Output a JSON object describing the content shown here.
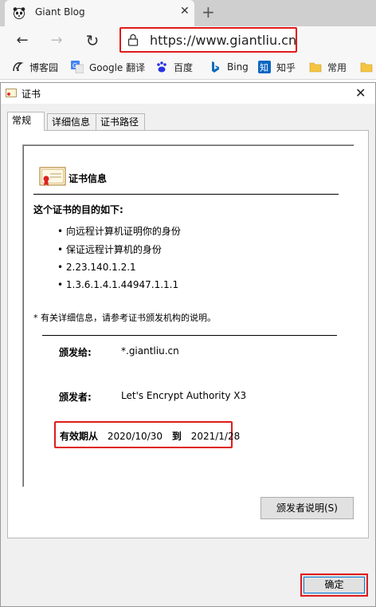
{
  "browser": {
    "tab_title": "Giant Blog",
    "tab_close": "✕",
    "new_tab": "+",
    "url": "https://www.giantliu.cn",
    "nav": {
      "back": "←",
      "forward": "→",
      "refresh": "↻"
    }
  },
  "favorites": [
    {
      "label": "博客园",
      "icon": "blog-icon"
    },
    {
      "label": "Google 翻译",
      "icon": "google-translate-icon"
    },
    {
      "label": "百度",
      "icon": "baidu-icon"
    },
    {
      "label": "Bing",
      "icon": "bing-icon"
    },
    {
      "label": "知乎",
      "icon": "zhihu-icon"
    },
    {
      "label": "常用",
      "icon": "folder-icon"
    }
  ],
  "dialog": {
    "title": "证书",
    "close": "✕",
    "tabs": [
      "常规",
      "详细信息",
      "证书路径"
    ],
    "cert_header": "证书信息",
    "purpose_header": "这个证书的目的如下:",
    "purposes": [
      "• 向远程计算机证明你的身份",
      "• 保证远程计算机的身份",
      "• 2.23.140.1.2.1",
      "• 1.3.6.1.4.1.44947.1.1.1"
    ],
    "footnote": "* 有关详细信息，请参考证书颁发机构的说明。",
    "issued_to_label": "颁发给:",
    "issued_to_value": "*.giantliu.cn",
    "issued_by_label": "颁发者:",
    "issued_by_value": "Let's Encrypt Authority X3",
    "valid_from_label": "有效期从",
    "valid_from": "2020/10/30",
    "valid_to_label": "到",
    "valid_to": "2021/1/28",
    "issuer_statement_button": "颁发者说明(S)",
    "ok_button": "确定"
  },
  "colors": {
    "highlight": "#e01b1b",
    "focus": "#0078d7"
  }
}
